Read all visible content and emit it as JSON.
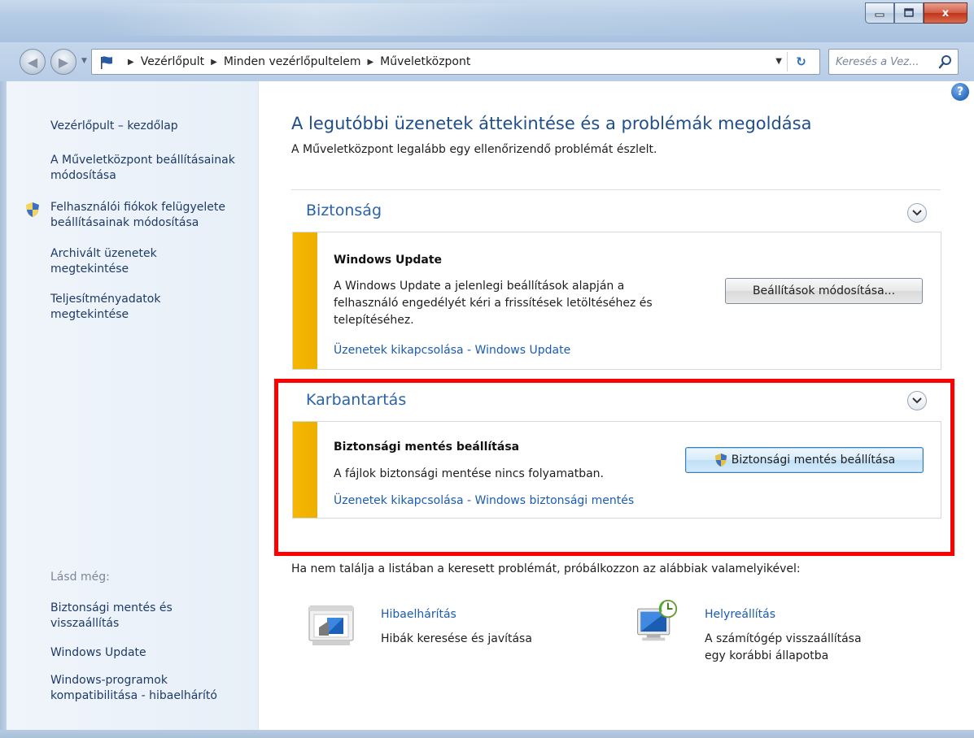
{
  "window": {
    "minimize_icon": "minimize-icon",
    "maximize_icon": "maximize-icon",
    "close_label": "x"
  },
  "nav": {
    "breadcrumbs": [
      "Vezérlőpult",
      "Minden vezérlőpultelem",
      "Műveletközpont"
    ],
    "search_placeholder": "Keresés a Vez..."
  },
  "sidebar": {
    "home": "Vezérlőpult – kezdőlap",
    "links": [
      "A Műveletközpont beállításainak módosítása",
      "Felhasználói fiókok felügyelete beállításainak módosítása",
      "Archivált üzenetek megtekintése",
      "Teljesítményadatok megtekintése"
    ],
    "see_also_label": "Lásd még:",
    "see_also": [
      "Biztonsági mentés és visszaállítás",
      "Windows Update",
      "Windows-programok kompatibilitása - hibaelhárító"
    ]
  },
  "main": {
    "title": "A legutóbbi üzenetek áttekintése és a problémák megoldása",
    "subtitle": "A Műveletközpont legalább egy ellenőrizendő problémát észlelt.",
    "sections": [
      {
        "heading": "Biztonság",
        "card": {
          "title": "Windows Update",
          "text": "A Windows Update a jelenlegi beállítások alapján a felhasználó engedélyét kéri a frissítések letöltéséhez és telepítéséhez.",
          "link": "Üzenetek kikapcsolása - Windows Update",
          "button": "Beállítások módosítása..."
        }
      },
      {
        "heading": "Karbantartás",
        "card": {
          "title": "Biztonsági mentés beállítása",
          "text": "A fájlok biztonsági mentése nincs folyamatban.",
          "link": "Üzenetek kikapcsolása - Windows biztonsági mentés",
          "button": "Biztonsági mentés beállítása"
        }
      }
    ],
    "footer": "Ha nem találja a listában a keresett problémát, próbálkozzon az alábbiak valamelyikével:",
    "tools": [
      {
        "title": "Hibaelhárítás",
        "desc": "Hibák keresése és javítása",
        "icon": "troubleshoot-icon"
      },
      {
        "title": "Helyreállítás",
        "desc": "A számítógép visszaállítása egy korábbi állapotba",
        "icon": "recovery-icon"
      }
    ]
  },
  "colors": {
    "link": "#1a5cb2",
    "heading": "#2a63a8",
    "warning_bar": "#f5b700",
    "highlight": "#ff0000"
  }
}
